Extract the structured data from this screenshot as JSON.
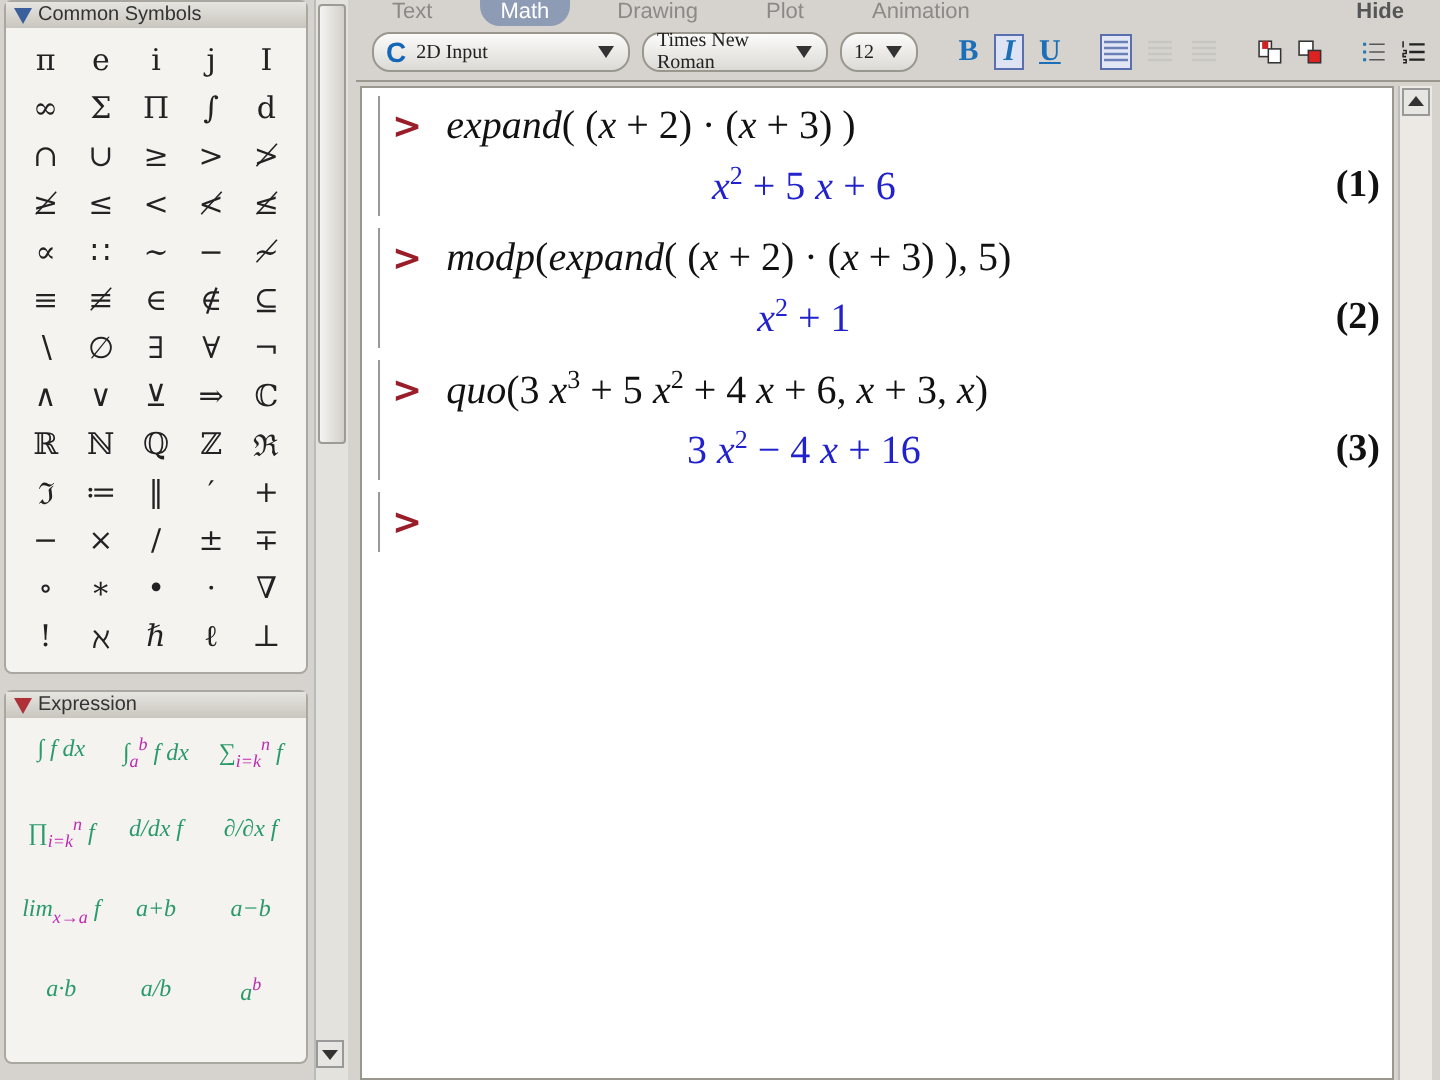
{
  "toolbar": {
    "modes": [
      {
        "label": "Text",
        "selected": false
      },
      {
        "label": "Math",
        "selected": true
      },
      {
        "label": "Drawing",
        "selected": false
      },
      {
        "label": "Plot",
        "selected": false
      },
      {
        "label": "Animation",
        "selected": false
      }
    ],
    "hide": "Hide",
    "input_mode": {
      "icon_letter": "C",
      "value": "2D Input"
    },
    "font": "Times New Roman",
    "size": "12",
    "format_buttons": [
      {
        "label": "B",
        "selected": false
      },
      {
        "label": "I",
        "selected": true
      },
      {
        "label": "U",
        "selected": false
      }
    ],
    "align_buttons": [
      {
        "selected": true
      },
      {
        "selected": false
      },
      {
        "selected": false
      }
    ]
  },
  "palettes": [
    {
      "title": "Common Symbols",
      "expanded": true,
      "kind": "symbols",
      "items": [
        "π",
        "e",
        "i",
        "j",
        "I",
        "∞",
        "Σ",
        "Π",
        "∫",
        "d",
        "∩",
        "∪",
        "≥",
        ">",
        "≯",
        "≱",
        "≤",
        "<",
        "≮",
        "≰",
        "∝",
        "∷",
        "∼",
        "−",
        "≁",
        "≡",
        "≢",
        "∈",
        "∉",
        "⊆",
        "∖",
        "∅",
        "∃",
        "∀",
        "¬",
        "∧",
        "∨",
        "⊻",
        "⇒",
        "ℂ",
        "ℝ",
        "ℕ",
        "ℚ",
        "ℤ",
        "ℜ",
        "ℑ",
        "≔",
        "‖",
        "′",
        "+",
        "−",
        "×",
        "/",
        "±",
        "∓",
        "∘",
        "∗",
        "•",
        "·",
        "∇",
        "!",
        "ℵ",
        "ℏ",
        "ℓ",
        "⊥"
      ]
    },
    {
      "title": "Expression",
      "expanded": true,
      "kind": "templates",
      "items": [
        "∫ f dx",
        "∫$_{a}$$^{b}$ f dx",
        "∑$_{i=k}$$^{n}$ f",
        "∏$_{i=k}$$^{n}$ f",
        "d/dx f",
        "∂/∂x f",
        "lim$_{x→a}$ f",
        "a+b",
        "a−b",
        "a·b",
        "a/b",
        "a$^{b}$"
      ]
    }
  ],
  "document": {
    "groups": [
      {
        "prompt": ">",
        "input": "*expand*( (*x* + 2) · (*x* + 3) )",
        "output": "*x*$^{2}$ + 5 *x* + 6",
        "label": "(1)"
      },
      {
        "prompt": ">",
        "input": "*modp*(*expand*( (*x* + 2) · (*x* + 3) ), 5)",
        "output": "*x*$^{2}$ + 1",
        "label": "(2)"
      },
      {
        "prompt": ">",
        "input": "*quo*(3 *x*$^{3}$ + 5 *x*$^{2}$ + 4 *x* + 6, *x* + 3, *x*)",
        "output": "3 *x*$^{2}$ − 4 *x* + 16",
        "label": "(3)"
      },
      {
        "prompt": ">"
      }
    ]
  }
}
